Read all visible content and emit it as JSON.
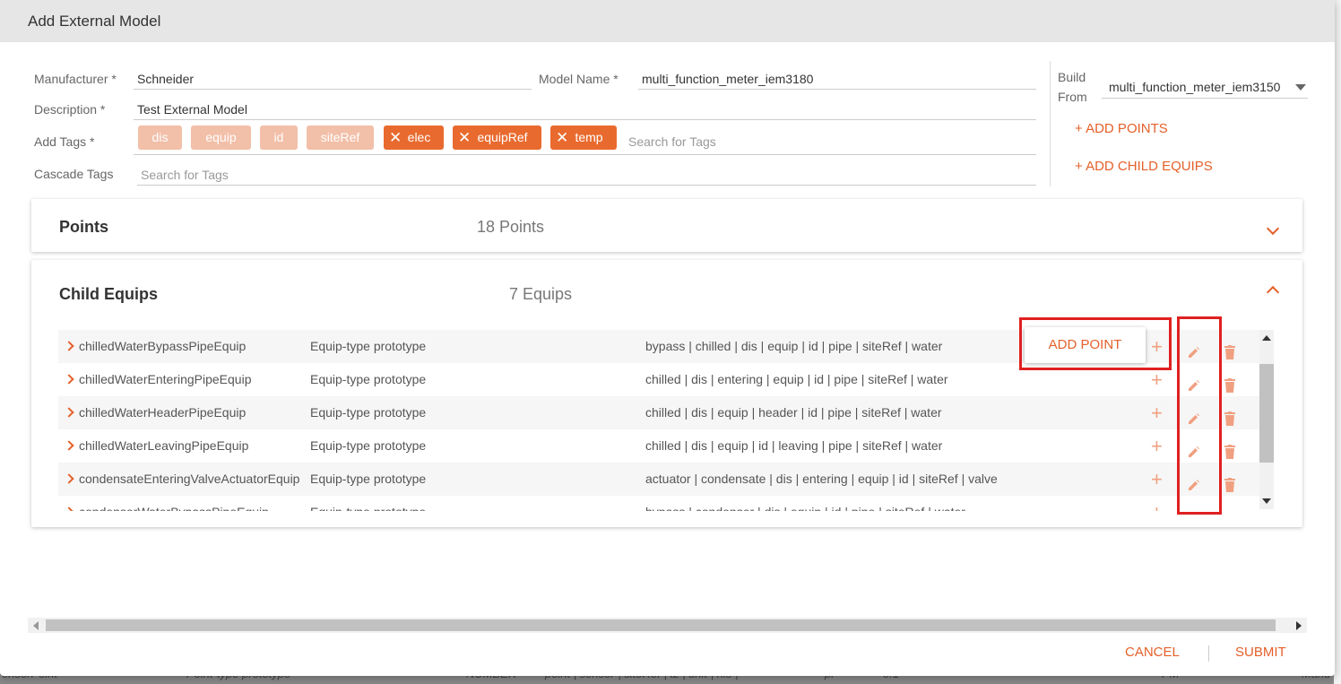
{
  "dialog": {
    "title": "Add External Model"
  },
  "form": {
    "manufacturer_label": "Manufacturer *",
    "manufacturer_value": "Schneider",
    "model_name_label": "Model Name *",
    "model_name_value": "multi_function_meter_iem3180",
    "description_label": "Description *",
    "description_value": "Test External Model",
    "add_tags_label": "Add Tags *",
    "tags_locked": [
      "dis",
      "equip",
      "id",
      "siteRef"
    ],
    "tags_removable": [
      "elec",
      "equipRef",
      "temp"
    ],
    "tag_search_placeholder": "Search for Tags",
    "cascade_tags_label": "Cascade Tags",
    "cascade_search_placeholder": "Search for Tags"
  },
  "side": {
    "build_from_label_1": "Build",
    "build_from_label_2": "From",
    "build_from_value": "multi_function_meter_iem3150",
    "add_points": "+ ADD POINTS",
    "add_child_equips": "+ ADD CHILD EQUIPS"
  },
  "points_panel": {
    "title": "Points",
    "count": "18 Points",
    "expanded": false
  },
  "child_panel": {
    "title": "Child Equips",
    "count": "7 Equips",
    "expanded": true,
    "rows": [
      {
        "name": "chilledWaterBypassPipeEquip",
        "type": "Equip-type prototype",
        "tags": "bypass | chilled | dis | equip | id | pipe | siteRef | water"
      },
      {
        "name": "chilledWaterEnteringPipeEquip",
        "type": "Equip-type prototype",
        "tags": "chilled | dis | entering | equip | id | pipe | siteRef | water"
      },
      {
        "name": "chilledWaterHeaderPipeEquip",
        "type": "Equip-type prototype",
        "tags": "chilled | dis | equip | header | id | pipe | siteRef | water"
      },
      {
        "name": "chilledWaterLeavingPipeEquip",
        "type": "Equip-type prototype",
        "tags": "chilled | dis | equip | id | leaving | pipe | siteRef | water"
      },
      {
        "name": "condensateEnteringValveActuatorEquip",
        "type": "Equip-type prototype",
        "tags": "actuator | condensate | dis | entering | equip | id | siteRef | valve"
      },
      {
        "name": "condenserWaterBypassPipeEquip",
        "type": "Equip-type prototype",
        "tags": "bypass | condenser | dis | equip | id | pipe | siteRef | water"
      }
    ],
    "add_point_popup": "ADD POINT"
  },
  "footer": {
    "cancel": "CANCEL",
    "submit": "SUBMIT"
  },
  "background": {
    "row_cells": [
      "ensorPoint",
      "Point-type prototype",
      "NUMBER",
      "point | sensor | siteRef | tz | unit | his |",
      "pr",
      "0.1",
      "PM",
      "Manu"
    ]
  },
  "colors": {
    "accent": "#e4602a",
    "tag_light": "#f2bfa8",
    "tag_dark": "#e96a2e",
    "highlight": "#e02020"
  },
  "icons": [
    "chevron-down-icon",
    "chevron-up-icon",
    "chevron-right-icon",
    "close-icon",
    "plus-icon",
    "pencil-icon",
    "trash-icon",
    "caret-down-icon"
  ]
}
